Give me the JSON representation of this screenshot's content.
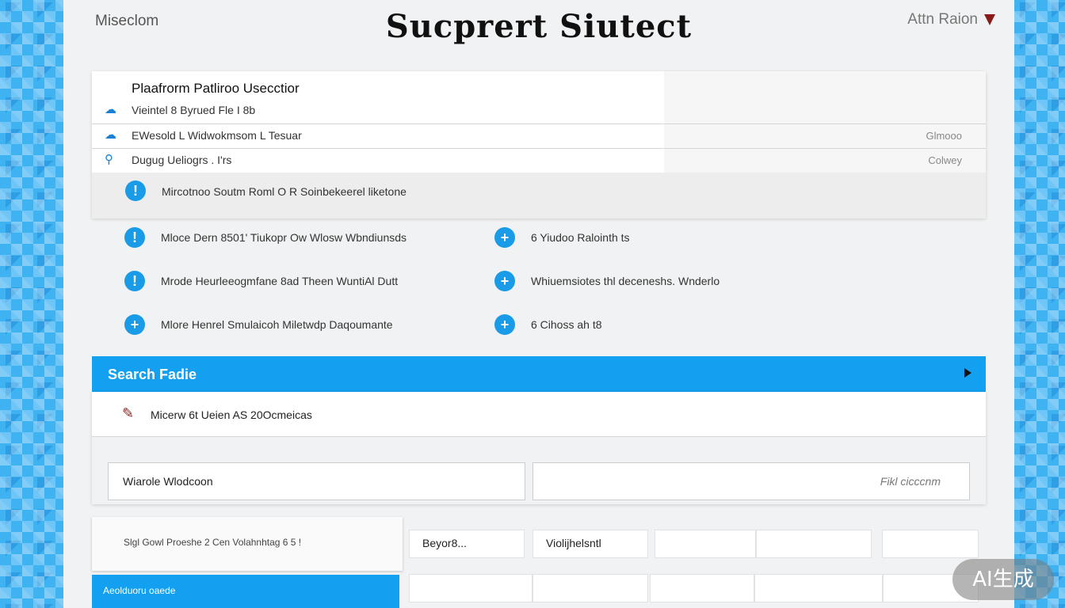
{
  "header": {
    "left_text": "Miseclom",
    "title": "Sucprert Siutect",
    "right_text": "Attn Raion"
  },
  "panel": {
    "title": "Plaafrorm Patliroo Usecctior",
    "rows": [
      {
        "icon": "cloud-icon",
        "label": "Vieintel 8 Byrued Fle I 8b",
        "right": ""
      },
      {
        "icon": "cloud-icon",
        "label": "EWesold L Widwokmsom L Tesuar",
        "right": "Glmooo"
      },
      {
        "icon": "pin-icon",
        "label": "Dugug Ueliogrs . I'rs",
        "right": "Colwey"
      }
    ],
    "footer_text": "Mircotnoo Soutm Roml O R Soinbekeerel liketone"
  },
  "options": {
    "left": [
      "Mloce Dern 8501' Tiukopr Ow Wlosw Wbndiunsds",
      "Mrode Heurleeogmfane 8ad Theen WuntiAl Dutt",
      "Mlore Henrel Smulaicoh Miletwdp Daqoumante"
    ],
    "right": [
      "6 Yiudoo Ralointh ts",
      "Whiuemsiotes thl deceneshs. Wnderlo",
      "6 Cihoss ah t8"
    ]
  },
  "search": {
    "bar_label": "Search Fadie",
    "result_text": "Micerw 6t Ueien AS 20Ocmeicas",
    "field_left_value": "Wiarole Wlodcoon",
    "field_right_value": "Fikl cicccnm"
  },
  "bottom": {
    "left_text": "Slgl Gowl Proeshe 2 Cen Volahnhtag 6 5 !",
    "left_bar_text": "Aeolduoru oaede",
    "cells_row1": [
      "Beyor8...",
      "Violijhelsntl",
      "",
      "",
      ""
    ],
    "cells_row2": [
      "",
      "",
      "",
      "",
      "",
      ""
    ]
  },
  "watermark": "AI生成"
}
